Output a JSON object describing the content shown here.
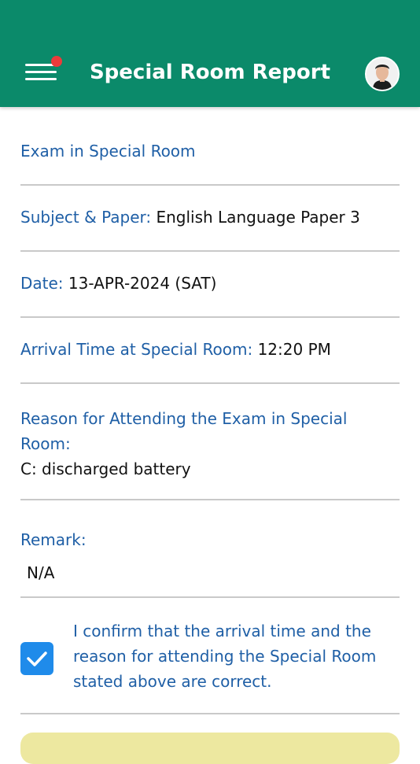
{
  "header": {
    "title": "Special Room Report",
    "menu_icon": "hamburger-menu-icon",
    "notification_color": "#ec3b3b",
    "avatar": "user-avatar-icon",
    "background_color": "#0b8a6a"
  },
  "report": {
    "heading": "Exam in Special Room",
    "subject_label": "Subject & Paper:",
    "subject_value": "English Language Paper 3",
    "date_label": "Date:",
    "date_value": "13-APR-2024 (SAT)",
    "arrival_label": "Arrival Time at Special Room:",
    "arrival_value": "12:20 PM",
    "reason_label": "Reason for Attending the Exam in Special Room:",
    "reason_value": "C: discharged battery",
    "remark_label": "Remark:",
    "remark_value": "N/A"
  },
  "confirmation": {
    "checked": true,
    "text": "I confirm that the arrival time and the reason for attending the Special Room stated above are correct."
  },
  "colors": {
    "label": "#1f5fa6",
    "checkbox": "#1f8bea",
    "footer_button": "#ede8a0"
  }
}
